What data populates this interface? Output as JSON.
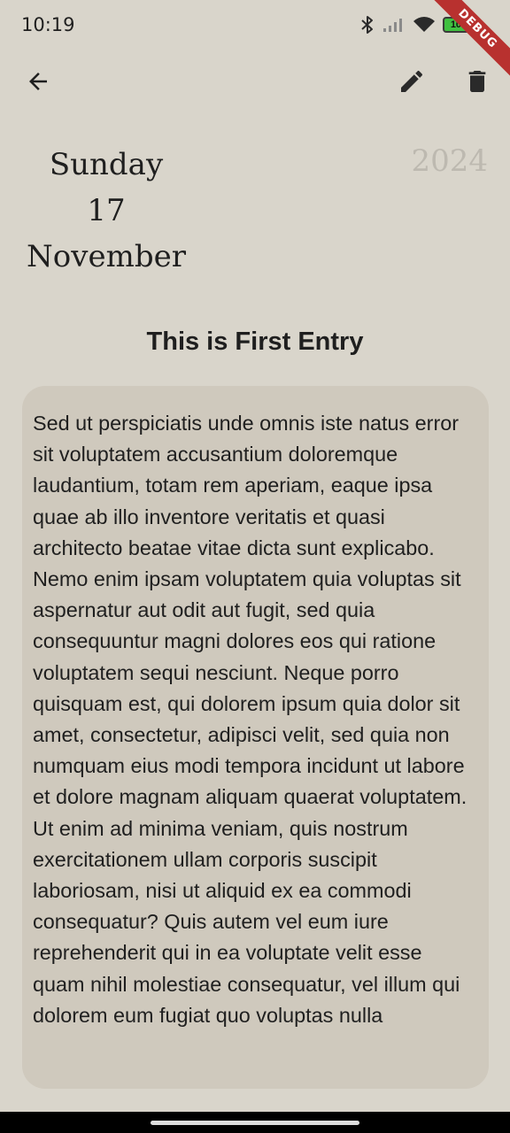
{
  "status_bar": {
    "time": "10:19",
    "battery_level": "100",
    "debug_label": "DEBUG",
    "icons": [
      "bluetooth-icon",
      "signal-icon",
      "wifi-icon",
      "battery-icon"
    ]
  },
  "app_bar": {
    "back_icon": "arrow-back-icon",
    "edit_icon": "edit-icon",
    "delete_icon": "delete-icon"
  },
  "entry": {
    "weekday": "Sunday",
    "day": "17",
    "month": "November",
    "year": "2024",
    "title": "This is First Entry",
    "body": "Sed ut perspiciatis unde omnis iste natus error sit voluptatem accusantium doloremque laudantium, totam rem aperiam, eaque ipsa quae ab illo inventore veritatis et quasi architecto beatae vitae dicta sunt explicabo. Nemo enim ipsam voluptatem quia voluptas sit aspernatur aut odit aut fugit, sed quia consequuntur magni dolores eos qui ratione voluptatem sequi nesciunt. Neque porro quisquam est, qui dolorem ipsum quia dolor sit amet, consectetur, adipisci velit, sed quia non numquam eius modi tempora incidunt ut labore et dolore magnam aliquam quaerat voluptatem. Ut enim ad minima veniam, quis nostrum exercitationem ullam corporis suscipit laboriosam, nisi ut aliquid ex ea commodi consequatur? Quis autem vel eum iure reprehenderit qui in ea voluptate velit esse quam nihil molestiae consequatur, vel illum qui dolorem eum fugiat quo voluptas nulla"
  },
  "colors": {
    "background": "#d9d5cb",
    "card": "#cfc9bd",
    "text": "#1f1f1f",
    "year_text": "#bdb9b0",
    "debug_ribbon": "#b8312f",
    "battery_fill": "#40c040"
  }
}
